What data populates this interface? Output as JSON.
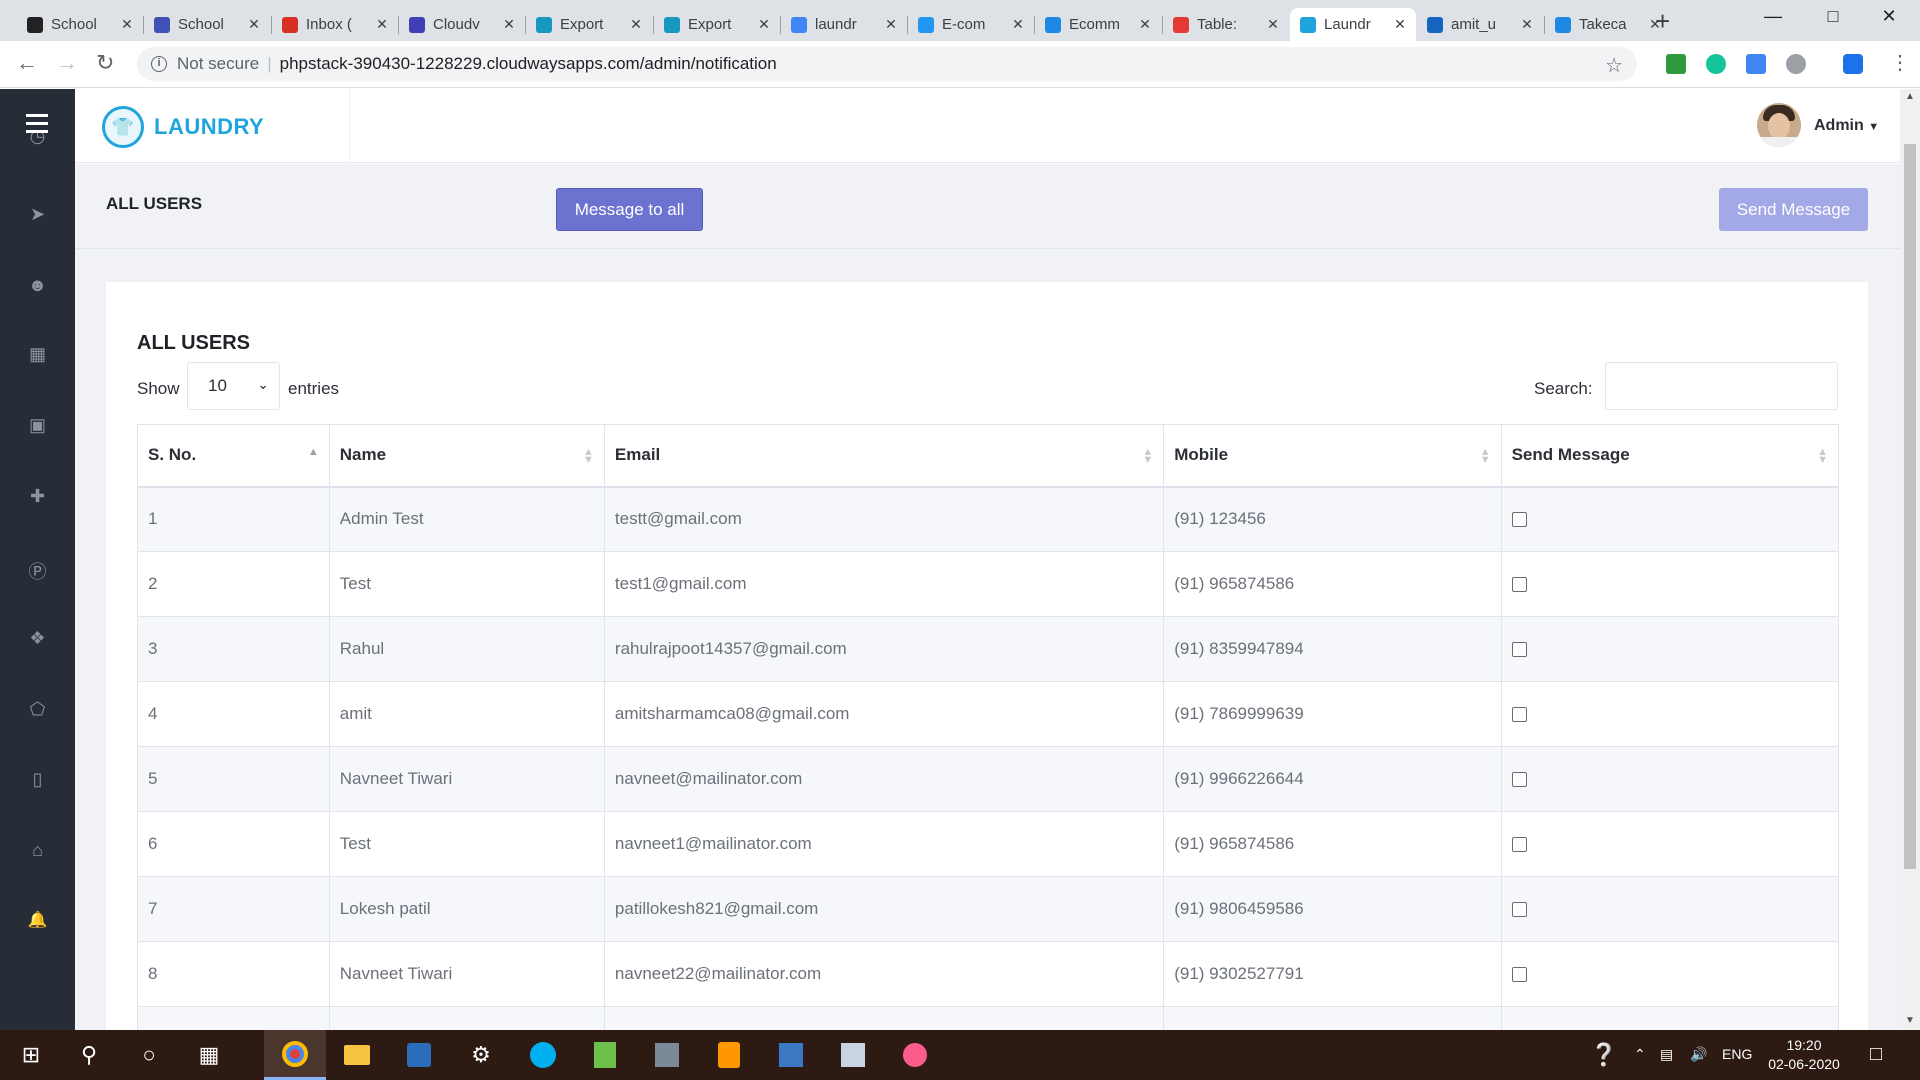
{
  "browser": {
    "tabs": [
      {
        "title": "School",
        "icon": "school-icon",
        "color": "#222222"
      },
      {
        "title": "School",
        "icon": "play-icon",
        "color": "#3f51b5"
      },
      {
        "title": "Inbox (",
        "icon": "gmail-icon",
        "color": "#d93025"
      },
      {
        "title": "Cloudv",
        "icon": "cloud-icon",
        "color": "#3f3fb8"
      },
      {
        "title": "Export",
        "icon": "salesforce-icon",
        "color": "#1798c1"
      },
      {
        "title": "Export",
        "icon": "salesforce-icon",
        "color": "#1798c1"
      },
      {
        "title": "laundr",
        "icon": "google-icon",
        "color": "#4285f4"
      },
      {
        "title": "E-com",
        "icon": "cart-icon",
        "color": "#2196f3"
      },
      {
        "title": "Ecomm",
        "icon": "m-icon",
        "color": "#1e88e5"
      },
      {
        "title": "Table: ",
        "icon": "table-icon",
        "color": "#e53935"
      },
      {
        "title": "Laundr",
        "icon": "laundry-icon",
        "color": "#1fa5dc",
        "active": true
      },
      {
        "title": "amit_u",
        "icon": "bookmark-icon",
        "color": "#1565c0"
      },
      {
        "title": "Takeca",
        "icon": "m-icon",
        "color": "#1e88e5"
      }
    ],
    "security": "Not secure",
    "url": "phpstack-390430-1228229.cloudwaysapps.com/admin/notification"
  },
  "app": {
    "brand": "LAUNDRY",
    "user": "Admin",
    "page_title": "ALL USERS",
    "message_all_label": "Message to all",
    "send_message_label": "Send Message",
    "accent_color": "#1fa5dc",
    "sidebar_icons": [
      "dashboard-icon",
      "send-icon",
      "user-icon",
      "table-icon",
      "ad-icon",
      "add-user-icon",
      "parking-icon",
      "gift-icon",
      "tag-icon",
      "mobile-icon",
      "cart-icon",
      "bell-icon"
    ]
  },
  "table_section": {
    "title": "ALL USERS",
    "show_label": "Show",
    "page_size": "10",
    "entries_label": "entries",
    "search_label": "Search:",
    "columns": [
      "S. No.",
      "Name",
      "Email",
      "Mobile",
      "Send Message"
    ],
    "rows": [
      {
        "sno": "1",
        "name": "Admin Test",
        "email": "testt@gmail.com",
        "mobile": "(91) 123456"
      },
      {
        "sno": "2",
        "name": "Test",
        "email": "test1@gmail.com",
        "mobile": "(91) 965874586"
      },
      {
        "sno": "3",
        "name": "Rahul",
        "email": "rahulrajpoot14357@gmail.com",
        "mobile": "(91) 8359947894"
      },
      {
        "sno": "4",
        "name": "amit",
        "email": "amitsharmamca08@gmail.com",
        "mobile": "(91) 7869999639"
      },
      {
        "sno": "5",
        "name": "Navneet Tiwari",
        "email": "navneet@mailinator.com",
        "mobile": "(91) 9966226644"
      },
      {
        "sno": "6",
        "name": "Test",
        "email": "navneet1@mailinator.com",
        "mobile": "(91) 965874586"
      },
      {
        "sno": "7",
        "name": "Lokesh patil",
        "email": "patillokesh821@gmail.com",
        "mobile": "(91) 9806459586"
      },
      {
        "sno": "8",
        "name": "Navneet Tiwari",
        "email": "navneet22@mailinator.com",
        "mobile": "(91) 9302527791"
      }
    ]
  },
  "taskbar": {
    "language": "ENG",
    "time": "19:20",
    "date": "02-06-2020"
  }
}
